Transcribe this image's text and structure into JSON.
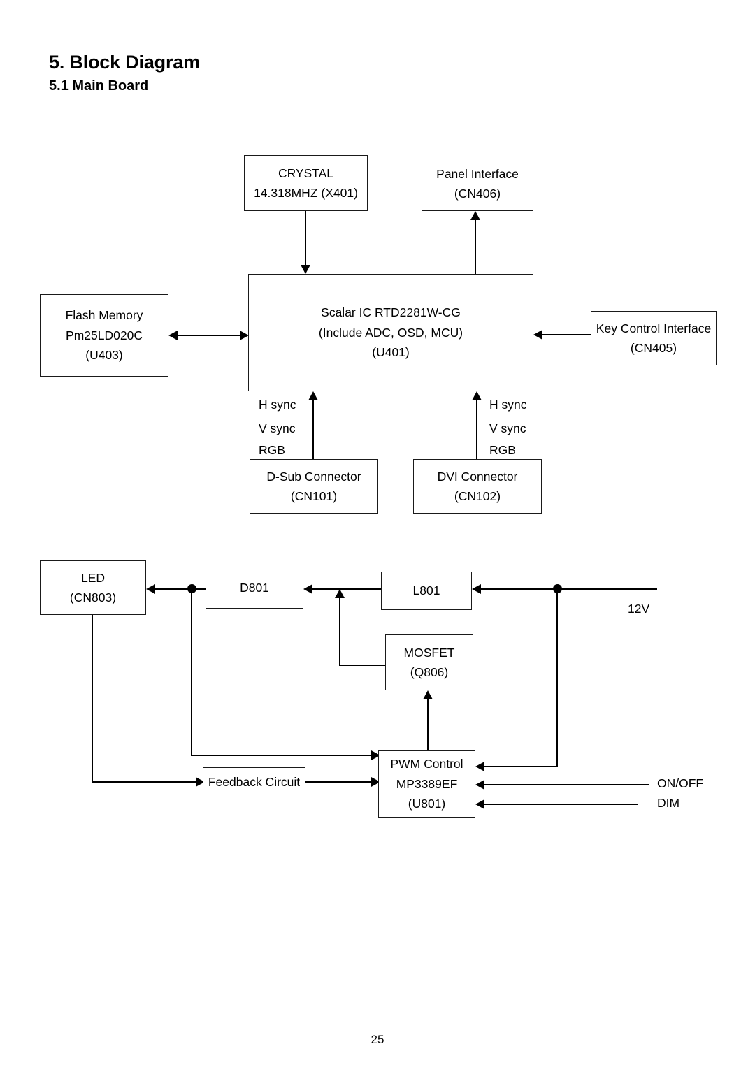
{
  "document": {
    "heading": "5. Block Diagram",
    "subheading": "5.1 Main Board",
    "page_number": "25"
  },
  "diagram": {
    "type": "block-diagram",
    "blocks": [
      {
        "id": "crystal",
        "lines": [
          "CRYSTAL",
          "14.318MHZ (X401)"
        ]
      },
      {
        "id": "panel",
        "lines": [
          "Panel Interface",
          "(CN406)"
        ]
      },
      {
        "id": "flash",
        "lines": [
          "Flash Memory",
          "Pm25LD020C",
          "(U403)"
        ]
      },
      {
        "id": "scalar",
        "lines": [
          "Scalar IC RTD2281W-CG",
          "(Include ADC, OSD, MCU)",
          "(U401)"
        ]
      },
      {
        "id": "key",
        "lines": [
          "Key Control Interface",
          "(CN405)"
        ]
      },
      {
        "id": "dsub",
        "lines": [
          "D-Sub Connector",
          "(CN101)"
        ]
      },
      {
        "id": "dvi",
        "lines": [
          "DVI Connector",
          "(CN102)"
        ]
      },
      {
        "id": "led",
        "lines": [
          "LED",
          "(CN803)"
        ]
      },
      {
        "id": "d801",
        "lines": [
          "D801"
        ]
      },
      {
        "id": "l801",
        "lines": [
          "L801"
        ]
      },
      {
        "id": "mosfet",
        "lines": [
          "MOSFET",
          "(Q806)"
        ]
      },
      {
        "id": "feedback",
        "lines": [
          "Feedback Circuit"
        ]
      },
      {
        "id": "pwm",
        "lines": [
          "PWM Control",
          "MP3389EF",
          "(U801)"
        ]
      }
    ],
    "signal_labels": {
      "dsub_hsync": "H sync",
      "dsub_vsync": "V sync",
      "dsub_rgb": "RGB",
      "dvi_hsync": "H sync",
      "dvi_vsync": "V sync",
      "dvi_rgb": "RGB",
      "rail_12v": "12V",
      "onoff": "ON/OFF",
      "dim": "DIM"
    }
  }
}
